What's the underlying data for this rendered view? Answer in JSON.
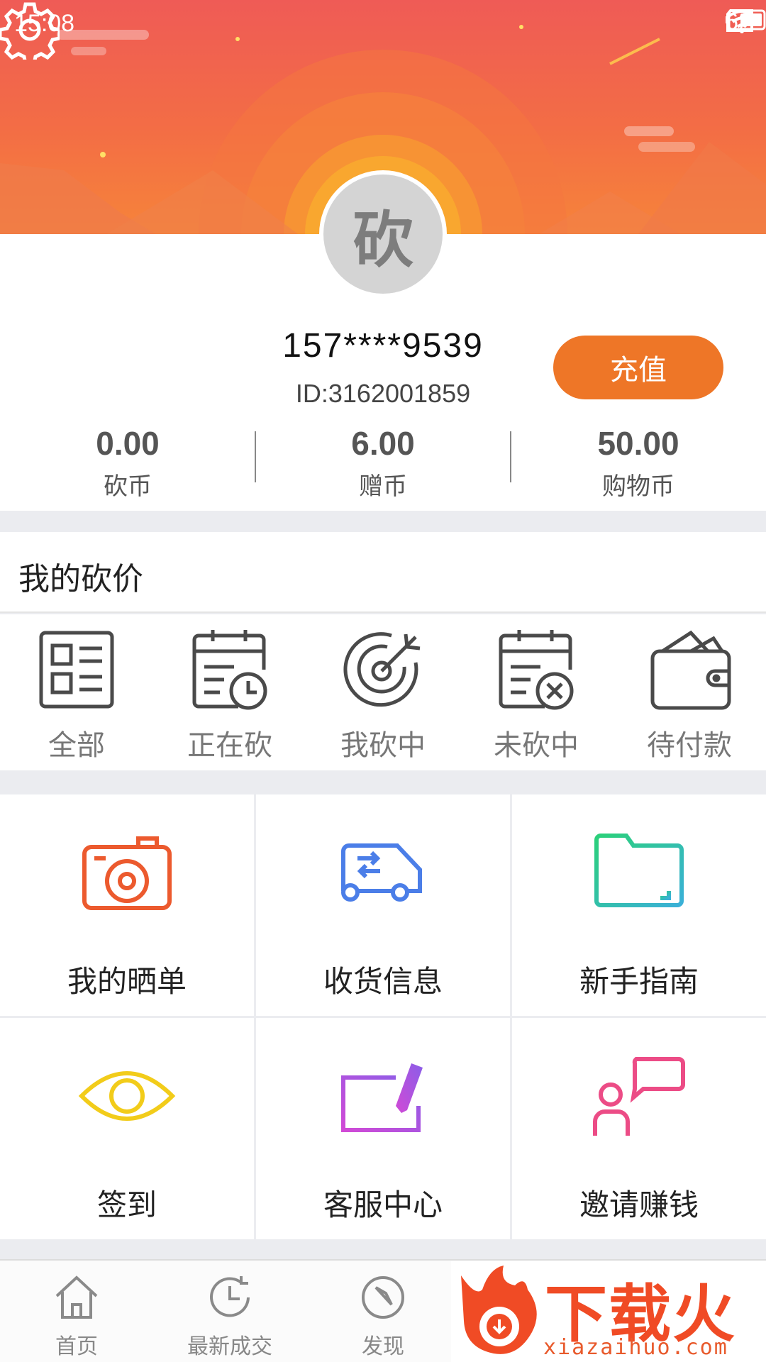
{
  "status_bar": {
    "time": "15:08",
    "battery": "62"
  },
  "profile": {
    "avatar_text": "砍",
    "phone": "157****9539",
    "user_id": "ID:3162001859",
    "recharge_label": "充值",
    "balances": [
      {
        "value": "0.00",
        "label": "砍币"
      },
      {
        "value": "6.00",
        "label": "赠币"
      },
      {
        "value": "50.00",
        "label": "购物币"
      }
    ]
  },
  "my_bargain": {
    "title": "我的砍价",
    "items": [
      {
        "label": "全部",
        "icon": "list-icon"
      },
      {
        "label": "正在砍",
        "icon": "calendar-clock-icon"
      },
      {
        "label": "我砍中",
        "icon": "target-icon"
      },
      {
        "label": "未砍中",
        "icon": "calendar-cancel-icon"
      },
      {
        "label": "待付款",
        "icon": "wallet-icon"
      }
    ]
  },
  "functions": [
    {
      "label": "我的晒单",
      "icon": "camera-icon",
      "color": "#ec5a2e"
    },
    {
      "label": "收货信息",
      "icon": "delivery-truck-icon",
      "color": "#4b7ee8"
    },
    {
      "label": "新手指南",
      "icon": "folder-icon",
      "color": "#2fc4a0"
    },
    {
      "label": "签到",
      "icon": "eye-icon",
      "color": "#f2cc1a"
    },
    {
      "label": "客服中心",
      "icon": "card-pen-icon",
      "color": "#b05ce8"
    },
    {
      "label": "邀请赚钱",
      "icon": "user-chat-icon",
      "color": "#ec4c86"
    }
  ],
  "tabbar": {
    "tabs": [
      {
        "label": "首页",
        "icon": "home-icon"
      },
      {
        "label": "最新成交",
        "icon": "history-icon"
      },
      {
        "label": "发现",
        "icon": "compass-icon"
      }
    ]
  },
  "watermark": {
    "title": "下载火",
    "url": "xiazaihuo.com"
  }
}
